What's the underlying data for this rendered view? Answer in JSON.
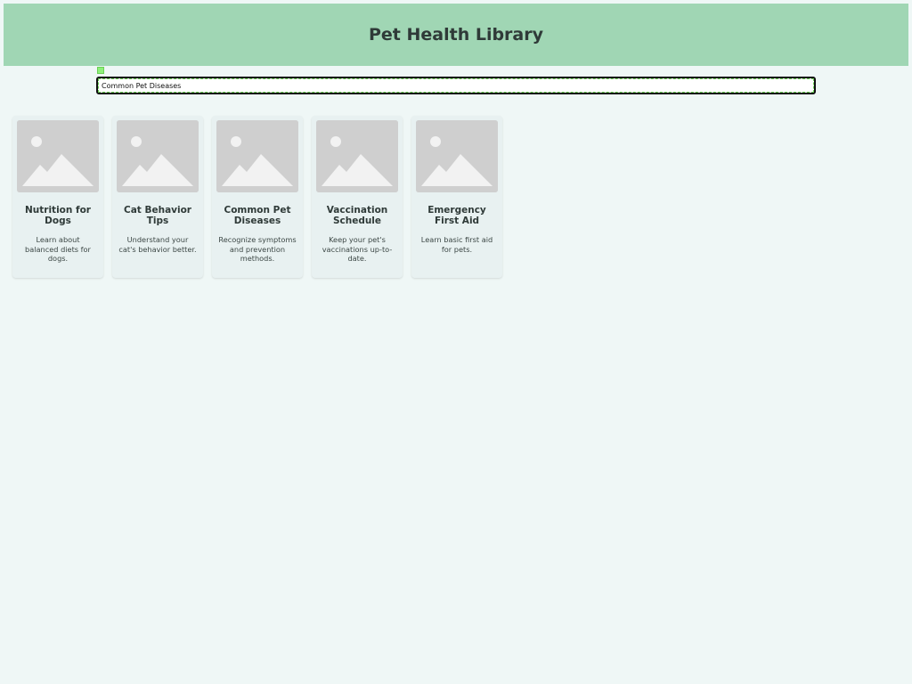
{
  "header": {
    "title": "Pet Health Library"
  },
  "search": {
    "value": "Common Pet Diseases"
  },
  "cards": [
    {
      "title": "Nutrition for Dogs",
      "description": "Learn about balanced diets for dogs.",
      "image_icon": "image-placeholder-icon"
    },
    {
      "title": "Cat Behavior Tips",
      "description": "Understand your cat's behavior better.",
      "image_icon": "image-placeholder-icon"
    },
    {
      "title": "Common Pet Diseases",
      "description": "Recognize symptoms and prevention methods.",
      "image_icon": "image-placeholder-icon"
    },
    {
      "title": "Vaccination Schedule",
      "description": "Keep your pet's vaccinations up-to-date.",
      "image_icon": "image-placeholder-icon"
    },
    {
      "title": "Emergency First Aid",
      "description": "Learn basic first aid for pets.",
      "image_icon": "image-placeholder-icon"
    }
  ],
  "colors": {
    "header_bg": "#a0d6b4",
    "page_bg": "#eff7f6",
    "card_bg": "#e8f1f1",
    "focus_marker": "#8ef07a"
  }
}
